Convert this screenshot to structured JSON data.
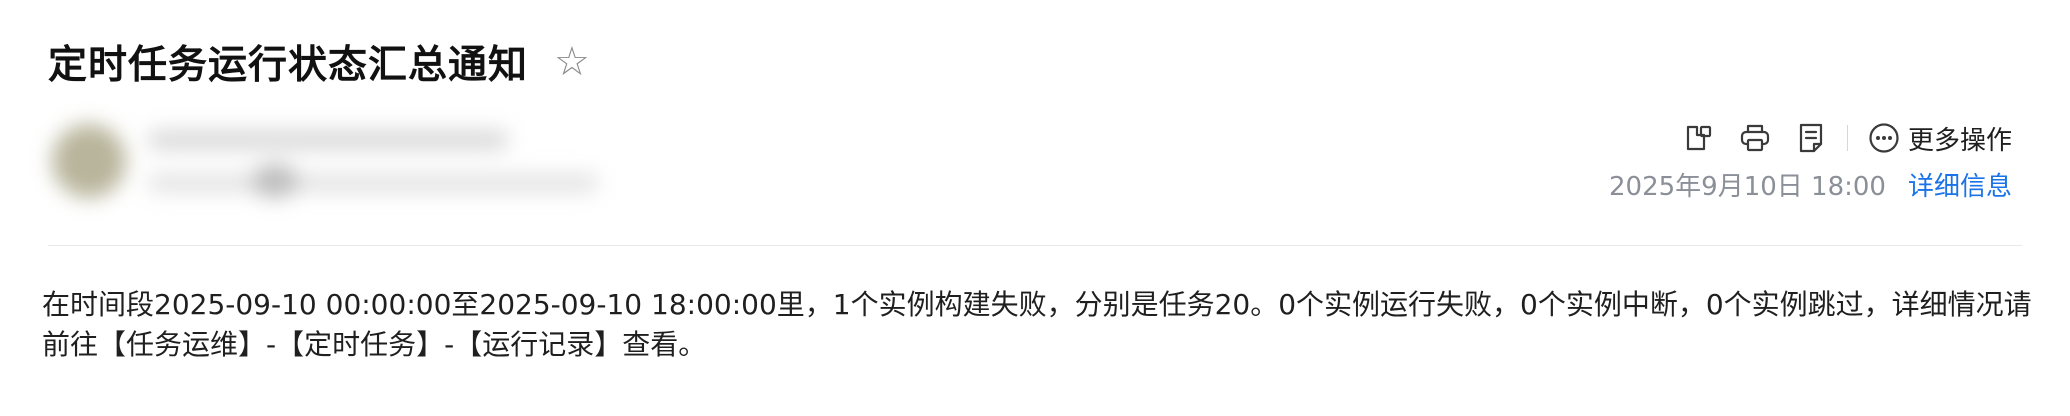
{
  "mail": {
    "subject": "定时任务运行状态汇总通知",
    "star_glyph": "☆"
  },
  "toolbar": {
    "icons": [
      "copy-link-icon",
      "print-icon",
      "note-icon",
      "more-circle-icon"
    ],
    "more_label": "更多操作"
  },
  "meta": {
    "date": "2025年9月10日 18:00",
    "detail_link": "详细信息"
  },
  "body": {
    "text": "在时间段2025-09-10 00:00:00至2025-09-10 18:00:00里，1个实例构建失败，分别是任务20。0个实例运行失败，0个实例中断，0个实例跳过，详细情况请前往【任务运维】-【定时任务】-【运行记录】查看。"
  },
  "colors": {
    "link": "#1a73e8",
    "meta_gray": "#8a8f98",
    "icon": "#3a3a3a",
    "star": "#8a8a8a"
  }
}
